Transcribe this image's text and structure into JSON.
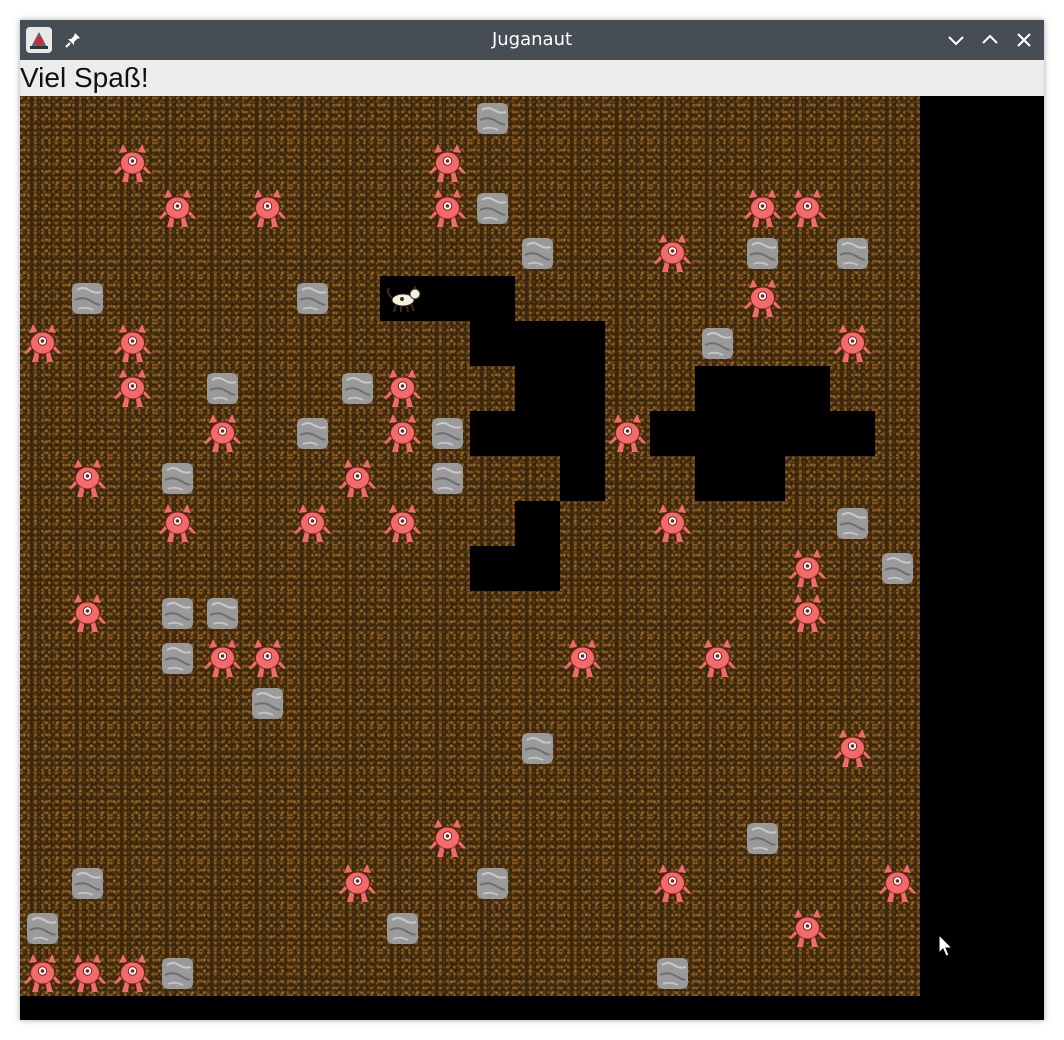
{
  "window": {
    "title": "Juganaut"
  },
  "status": {
    "message": "Viel Spaß!"
  },
  "icons": {
    "app": "juganaut-app-icon",
    "pin": "pin-icon",
    "minimize": "chevron-down-icon",
    "maximize": "chevron-up-icon",
    "close": "close-icon"
  },
  "colors": {
    "titlebar": "#474d55",
    "statusbar": "#ececec",
    "dirt": "#3a2710",
    "monster": "#f26a6a",
    "rock": "#9a9a9a"
  },
  "board": {
    "cols": 20,
    "rows": 20,
    "legend": {
      "D": "dirt",
      "E": "empty",
      "R": "rock",
      "M": "monster",
      "P": "player"
    },
    "map": [
      "DDDDDDDDDDRDDDDDDDDD",
      "DDMDDDDDDMDDDDDDDDDD",
      "DDDMDMDDDMRDDDDDMMDD",
      "DDDDDDDDDDDRDDMDRDRD",
      "DRDDDDRDPEEDDDDDMDDD",
      "MDMDDDDDDDEEEDDRDDMDM",
      "DDMDRDDRMDDEEDDEEEDDD",
      "DDDDMDRDMREEEMEEEEEDD",
      "DMDRDDDMDRDDEDDEEDDD",
      "DDDMDDMDMDDEDDMDDDRDD",
      "DDDDDDDDDDEEDDDDDMDRD",
      "DMDRRDDDDDDDDDDDDMDDD",
      "DDDRMMDDDDDDMDDMDDDDD",
      "DDDDDRDDDDDDDDDDDDDD",
      "DDDDDDDDDDDRDDDDDDMD",
      "DDDDDDDDDDDDDDDDDDDD",
      "DDDDDDDDDMDDDDDDRDDD",
      "DRDDDDDMDDRDDDMDDDDM",
      "RDDDDDDDRDDDDDDDDMDD",
      "MMMRDDDDDDDDDDRDDDDD"
    ]
  }
}
